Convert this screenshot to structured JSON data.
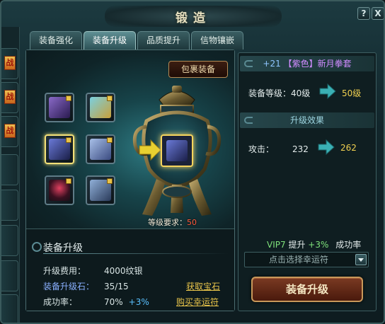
{
  "window": {
    "title": "锻造",
    "help_label": "?",
    "close_label": "X"
  },
  "side_tabs": [
    {
      "badge": "战"
    },
    {
      "badge": "战"
    },
    {
      "badge": "战"
    }
  ],
  "tabs": [
    {
      "label": "装备强化",
      "active": false
    },
    {
      "label": "装备升级",
      "active": true
    },
    {
      "label": "品质提升",
      "active": false
    },
    {
      "label": "信物镶嵌",
      "active": false
    }
  ],
  "forge": {
    "bag_button": "包裹装备",
    "requirement_label": "等级要求：",
    "requirement_value": "50",
    "item_slots": [
      {
        "icon": "dagger-icon",
        "color": "#6a4aa0",
        "locked": true,
        "selected": false
      },
      {
        "icon": "helmet-icon",
        "color": "#4aa0b0",
        "locked": true,
        "selected": false
      },
      {
        "icon": "dagger-icon",
        "color": "#4a5ab0",
        "locked": true,
        "selected": true
      },
      {
        "icon": "armor-icon",
        "color": "#6a8ac0",
        "locked": true,
        "selected": false
      },
      {
        "icon": "amulet-icon",
        "color": "#a03a5a",
        "locked": true,
        "selected": false
      },
      {
        "icon": "boots-icon",
        "color": "#4a6a90",
        "locked": true,
        "selected": false
      }
    ]
  },
  "upgrade_info": {
    "title": "装备升级",
    "cost_label": "升级费用：",
    "cost_value": "4000纹银",
    "stone_label": "装备升级石：",
    "stone_value": "35/15",
    "rate_label": "成功率：",
    "rate_value": "70%",
    "rate_bonus": "+3%",
    "get_stone_link": "获取宝石",
    "buy_luck_link": "购买幸运符"
  },
  "right_panel": {
    "set_prefix": "+21",
    "set_quality": "【紫色】",
    "set_name": "新月拳套",
    "level_label": "装备等级：",
    "level_from": "40级",
    "level_to": "50级",
    "effect_header": "升级效果",
    "attack_label": "攻击：",
    "attack_from": "232",
    "attack_to": "262",
    "vip_label": "VIP7",
    "boost_label": "提升",
    "boost_value": "+3%",
    "success_label": "成功率",
    "luck_placeholder": "点击选择幸运符",
    "upgrade_button": "装备升级"
  }
}
